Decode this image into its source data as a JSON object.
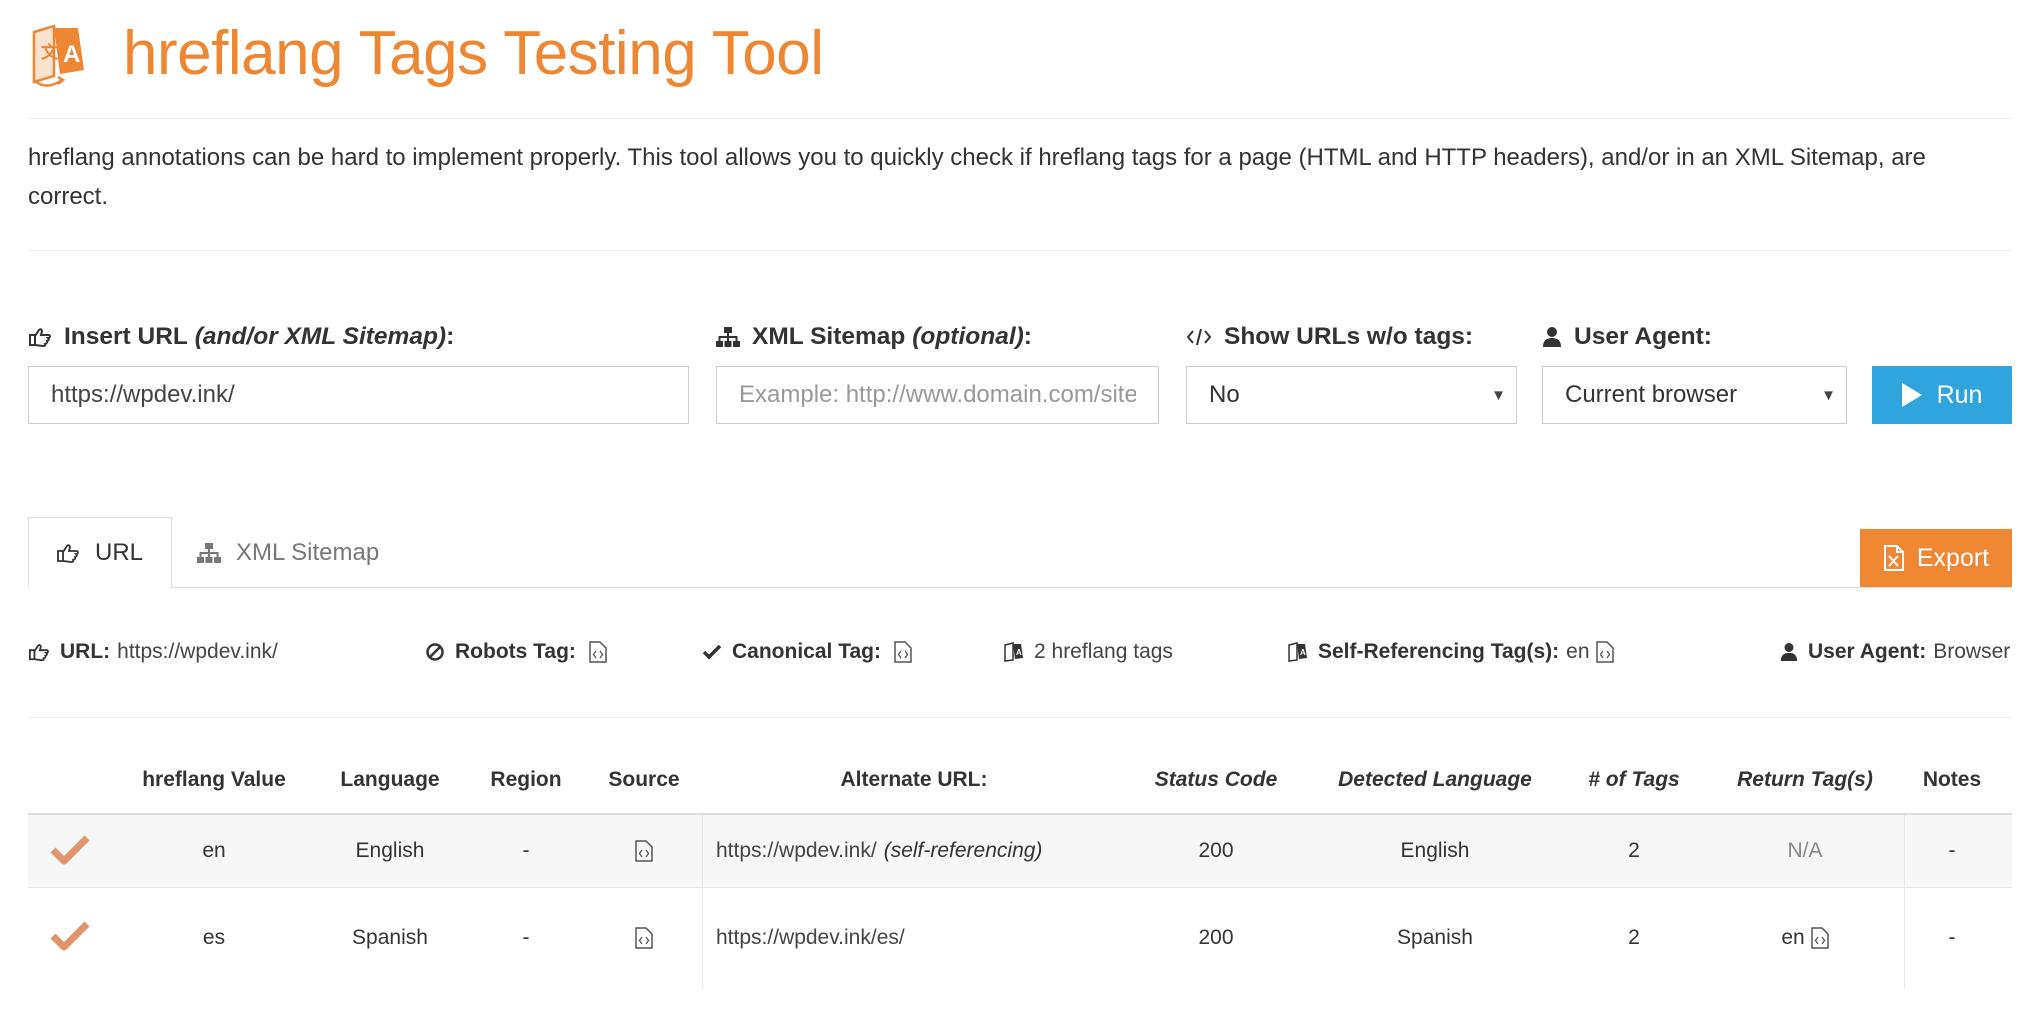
{
  "header": {
    "title": "hreflang Tags Testing Tool",
    "logo_icon": "translate-logo-icon",
    "intro": "hreflang annotations can be hard to implement properly. This tool allows you to quickly check if hreflang tags for a page (HTML and HTTP headers), and/or in an XML Sitemap, are correct."
  },
  "form": {
    "url_label": "Insert URL",
    "url_label_em": "(and/or XML Sitemap)",
    "url_label_suffix": ":",
    "url_value": "https://wpdev.ink/",
    "sitemap_label": "XML Sitemap",
    "sitemap_label_em": "(optional)",
    "sitemap_label_suffix": ":",
    "sitemap_placeholder": "Example: http://www.domain.com/sitemap.xml",
    "show_urls_label": "Show URLs w/o tags:",
    "show_urls_value": "No",
    "user_agent_label": "User Agent:",
    "user_agent_value": "Current browser",
    "run_label": "Run"
  },
  "tabs": [
    {
      "label": "URL",
      "active": true
    },
    {
      "label": "XML Sitemap",
      "active": false
    }
  ],
  "export_label": "Export",
  "summary": {
    "url_label": "URL:",
    "url_value": "https://wpdev.ink/",
    "robots_label": "Robots Tag:",
    "canonical_label": "Canonical Tag:",
    "hreflang_count": "2 hreflang tags",
    "self_ref_label": "Self-Referencing Tag(s):",
    "self_ref_value": "en",
    "user_agent_label": "User Agent:",
    "user_agent_value": "Browser"
  },
  "table": {
    "headers": {
      "hreflang": "hreflang Value",
      "language": "Language",
      "region": "Region",
      "source": "Source",
      "alternate": "Alternate URL:",
      "status": "Status Code",
      "detected": "Detected Language",
      "tags": "# of Tags",
      "return": "Return Tag(s)",
      "notes": "Notes"
    },
    "rows": [
      {
        "hreflang": "en",
        "language": "English",
        "region": "-",
        "alternate_url": "https://wpdev.ink/",
        "alternate_note": "(self-referencing)",
        "status": "200",
        "detected": "English",
        "tags": "2",
        "return": "N/A",
        "notes": "-"
      },
      {
        "hreflang": "es",
        "language": "Spanish",
        "region": "-",
        "alternate_url": "https://wpdev.ink/es/",
        "alternate_note": "",
        "status": "200",
        "detected": "Spanish",
        "tags": "2",
        "return": "en",
        "notes": "-"
      }
    ]
  },
  "colors": {
    "brand_orange": "#ee8733",
    "run_blue": "#2fa4dd",
    "check_orange": "#e0956a"
  }
}
